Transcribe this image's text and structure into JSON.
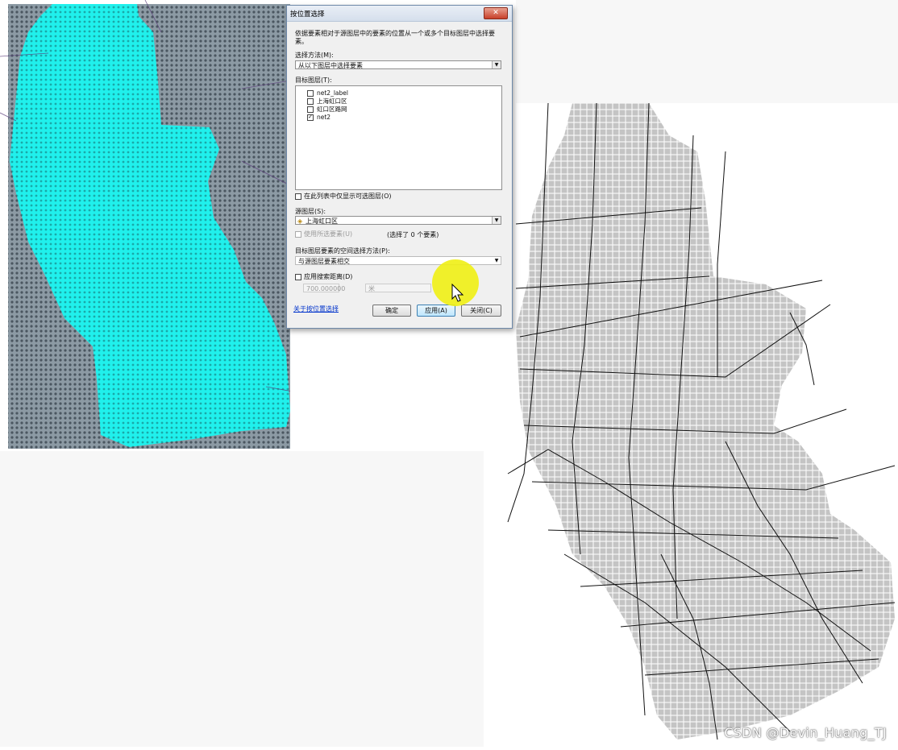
{
  "dialog": {
    "title": "按位置选择",
    "close": "✕",
    "description": "依据要素相对于源图层中的要素的位置从一个或多个目标图层中选择要素。",
    "method_label": "选择方法(M):",
    "method_value": "从以下图层中选择要素",
    "target_label": "目标图层(T):",
    "target_layers": [
      {
        "name": "net2_label",
        "checked": false
      },
      {
        "name": "上海虹口区",
        "checked": false
      },
      {
        "name": "虹口区路网",
        "checked": false
      },
      {
        "name": "net2",
        "checked": true
      }
    ],
    "only_selectable": "在此列表中仅显示可选图层(O)",
    "source_label": "源图层(S):",
    "source_value": "上海虹口区",
    "use_selected": "使用所选要素(U)",
    "selected_count": "(选择了 0 个要素)",
    "spatial_method_label": "目标图层要素的空间选择方法(P):",
    "spatial_method_value": "与源图层要素相交",
    "search_distance": "应用搜索距离(D)",
    "distance_value": "700.000000",
    "distance_unit": "米",
    "help_link": "关于按位置选择",
    "ok": "确定",
    "apply": "应用(A)",
    "close_button": "关闭(C)"
  },
  "watermark": "CSDN @Devin_Huang_TJ",
  "colors": {
    "selection": "#22f2ee",
    "grid": "#7a8a96",
    "right_grid": "#c4c4c4"
  }
}
